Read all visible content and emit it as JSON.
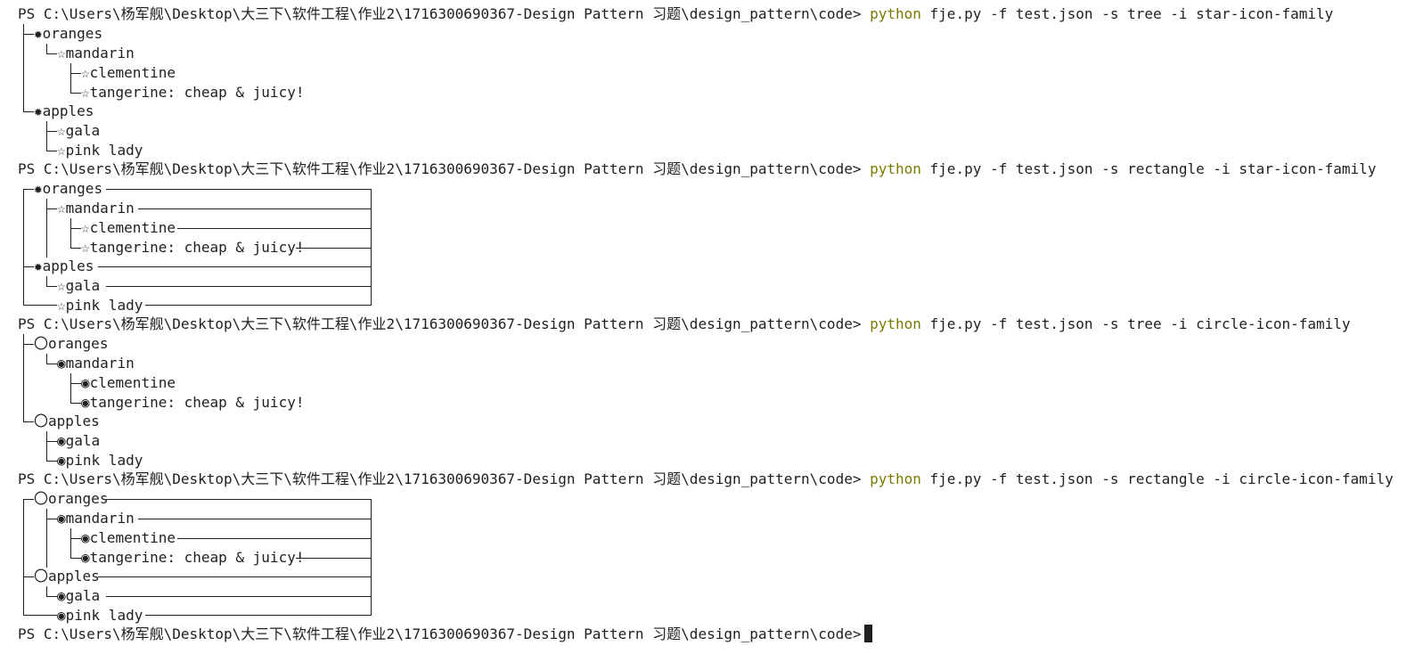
{
  "prompt": "PS C:\\Users\\杨军舰\\Desktop\\大三下\\软件工程\\作业2\\1716300690367-Design Pattern 习题\\design_pattern\\code>",
  "commands": [
    {
      "cmd": "python",
      "args": " fje.py -f test.json -s tree -i star-icon-family"
    },
    {
      "cmd": "python",
      "args": " fje.py -f test.json -s rectangle -i star-icon-family"
    },
    {
      "cmd": "python",
      "args": " fje.py -f test.json -s tree -i circle-icon-family"
    },
    {
      "cmd": "python",
      "args": " fje.py -f test.json -s rectangle -i circle-icon-family"
    }
  ],
  "tree_labels": {
    "oranges": "oranges",
    "mandarin": "mandarin",
    "clementine": "clementine",
    "tangerine": "tangerine: cheap & juicy!",
    "apples": "apples",
    "gala": "gala",
    "pink_lady": "pink lady"
  },
  "icons": {
    "star_container": "✹",
    "star_leaf": "☆",
    "circle_container": "〇",
    "circle_leaf": "◉"
  },
  "colors": {
    "command": "#7a7a00",
    "text": "#1f1f1f",
    "background": "#ffffff"
  }
}
